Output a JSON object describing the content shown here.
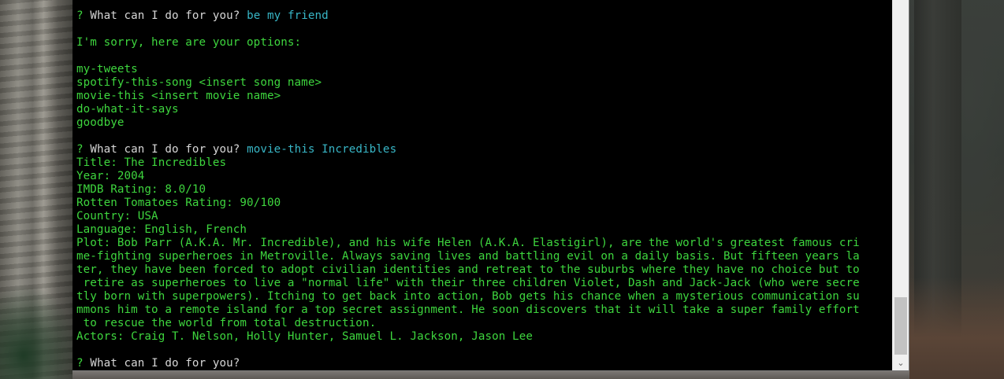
{
  "console": {
    "lines": [
      {
        "kind": "prompt",
        "q": "?",
        "prompt": "What can I do for you?",
        "answer": "be my friend"
      },
      {
        "kind": "blank"
      },
      {
        "kind": "text",
        "text": "I'm sorry, here are your options:"
      },
      {
        "kind": "blank"
      },
      {
        "kind": "text",
        "text": "my-tweets"
      },
      {
        "kind": "text",
        "text": "spotify-this-song <insert song name>"
      },
      {
        "kind": "text",
        "text": "movie-this <insert movie name>"
      },
      {
        "kind": "text",
        "text": "do-what-it-says"
      },
      {
        "kind": "text",
        "text": "goodbye"
      },
      {
        "kind": "blank"
      },
      {
        "kind": "prompt",
        "q": "?",
        "prompt": "What can I do for you?",
        "answer": "movie-this Incredibles"
      },
      {
        "kind": "text",
        "text": "Title: The Incredibles"
      },
      {
        "kind": "text",
        "text": "Year: 2004"
      },
      {
        "kind": "text",
        "text": "IMDB Rating: 8.0/10"
      },
      {
        "kind": "text",
        "text": "Rotten Tomatoes Rating: 90/100"
      },
      {
        "kind": "text",
        "text": "Country: USA"
      },
      {
        "kind": "text",
        "text": "Language: English, French"
      },
      {
        "kind": "text",
        "text": "Plot: Bob Parr (A.K.A. Mr. Incredible), and his wife Helen (A.K.A. Elastigirl), are the world's greatest famous cri"
      },
      {
        "kind": "text",
        "text": "me-fighting superheroes in Metroville. Always saving lives and battling evil on a daily basis. But fifteen years la"
      },
      {
        "kind": "text",
        "text": "ter, they have been forced to adopt civilian identities and retreat to the suburbs where they have no choice but to"
      },
      {
        "kind": "text",
        "text": " retire as superheroes to live a \"normal life\" with their three children Violet, Dash and Jack-Jack (who were secre"
      },
      {
        "kind": "text",
        "text": "tly born with superpowers). Itching to get back into action, Bob gets his chance when a mysterious communication su"
      },
      {
        "kind": "text",
        "text": "mmons him to a remote island for a top secret assignment. He soon discovers that it will take a super family effort"
      },
      {
        "kind": "text",
        "text": " to rescue the world from total destruction."
      },
      {
        "kind": "text",
        "text": "Actors: Craig T. Nelson, Holly Hunter, Samuel L. Jackson, Jason Lee"
      },
      {
        "kind": "blank"
      },
      {
        "kind": "prompt",
        "q": "?",
        "prompt": "What can I do for you?",
        "answer": ""
      }
    ]
  },
  "scrollbar": {
    "down_arrow_icon": "chevron-down-icon",
    "arrow_glyph": "⌄"
  },
  "colors": {
    "text_green": "#3ed63e",
    "prompt_white": "#d7d7d7",
    "answer_cyan": "#38b6c6",
    "console_bg": "#000000"
  }
}
